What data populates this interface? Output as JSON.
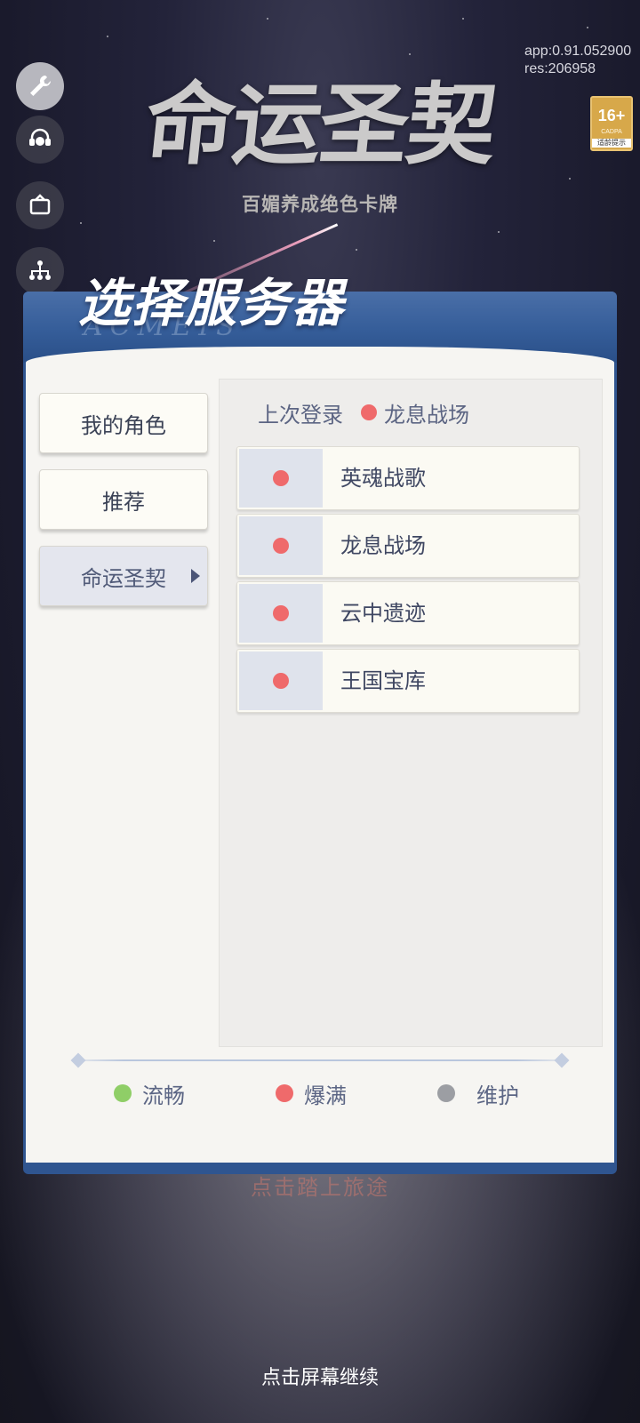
{
  "game": {
    "logo_text": "命运圣契",
    "tagline": "百媚养成绝色卡牌"
  },
  "version": {
    "app": "app:0.91.052900",
    "res": "res:206958"
  },
  "age_rating": {
    "age": "16+",
    "cadpa": "CADPA",
    "tip": "适龄提示"
  },
  "tools": [
    {
      "icon": "wrench-icon",
      "active": true
    },
    {
      "icon": "customer-service-icon",
      "active": false
    },
    {
      "icon": "notice-board-icon",
      "active": false
    },
    {
      "icon": "network-icon",
      "active": false
    }
  ],
  "dialog": {
    "title": "选择服务器",
    "subtitle": "ACMEIS",
    "tabs": [
      {
        "label": "我的角色",
        "selected": false
      },
      {
        "label": "推荐",
        "selected": false
      },
      {
        "label": "命运圣契",
        "selected": true
      }
    ],
    "last_login": {
      "label": "上次登录",
      "server": "龙息战场",
      "status": "red"
    },
    "servers": [
      {
        "name": "英魂战歌",
        "status": "red"
      },
      {
        "name": "龙息战场",
        "status": "red"
      },
      {
        "name": "云中遗迹",
        "status": "red"
      },
      {
        "name": "王国宝库",
        "status": "red"
      }
    ],
    "legend": [
      {
        "label": "流畅",
        "status": "green"
      },
      {
        "label": "爆满",
        "status": "red"
      },
      {
        "label": "维护",
        "status": "gray"
      }
    ]
  },
  "background_button": "点击踏上旅途",
  "tap_hint": "点击屏幕继续",
  "colors": {
    "red_status": "#ef6a6b",
    "green_status": "#8fce67",
    "gray_status": "#9c9ea3",
    "dialog_blue": "#2f5590"
  }
}
